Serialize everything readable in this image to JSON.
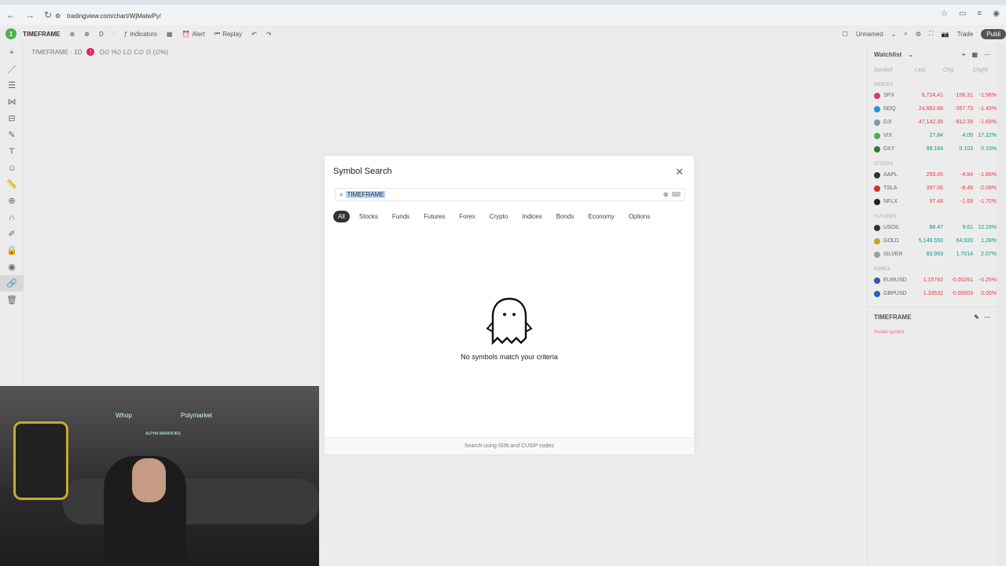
{
  "browser": {
    "url": "tradingview.com/chart/WjMatwPy/"
  },
  "toolbar": {
    "avatar": "1",
    "symbol": "TIMEFRAME",
    "interval": "D",
    "indicators": "Indicators",
    "alert": "Alert",
    "replay": "Replay",
    "layout_name": "Unnamed",
    "trade": "Trade",
    "publish": "Publi"
  },
  "chart": {
    "legend_title": "TIMEFRAME · 1D",
    "ohlc": "O∅ H∅ L∅ C∅ ∅ (∅%)"
  },
  "watchlist": {
    "title": "Watchlist",
    "cols": [
      "Symbol",
      "Last",
      "Chg",
      "Chg%"
    ],
    "sections": [
      {
        "name": "INDICES",
        "rows": [
          {
            "sym": "SPX",
            "last": "6,724.41",
            "chg": "-106.31",
            "pct": "-1.56%",
            "color": "#d23f67"
          },
          {
            "sym": "NDQ",
            "last": "24,662.68",
            "chg": "-357.73",
            "pct": "-1.43%",
            "color": "#2b8fd6"
          },
          {
            "sym": "DJI",
            "last": "47,142.35",
            "chg": "-812.39",
            "pct": "-1.69%",
            "color": "#8a94a0"
          },
          {
            "sym": "VIX",
            "last": "27.84",
            "chg": "4.09",
            "pct": "17.22%",
            "color": "#4caf50"
          },
          {
            "sym": "DXY",
            "last": "99.164",
            "chg": "0.103",
            "pct": "0.10%",
            "color": "#2e7d32"
          }
        ]
      },
      {
        "name": "STOCKS",
        "rows": [
          {
            "sym": "AAPL",
            "last": "255.45",
            "chg": "-4.84",
            "pct": "-1.86%",
            "color": "#333"
          },
          {
            "sym": "TSLA",
            "last": "397.06",
            "chg": "-8.49",
            "pct": "-2.09%",
            "color": "#d32f2f"
          },
          {
            "sym": "NFLX",
            "last": "97.48",
            "chg": "-1.69",
            "pct": "-1.70%",
            "color": "#222"
          }
        ]
      },
      {
        "name": "FUTURES",
        "rows": [
          {
            "sym": "USOIL",
            "last": "88.47",
            "chg": "9.61",
            "pct": "12.19%",
            "color": "#333"
          },
          {
            "sym": "GOLD",
            "last": "5,149.550",
            "chg": "64.920",
            "pct": "1.28%",
            "color": "#c9a227"
          },
          {
            "sym": "SILVER",
            "last": "83.963",
            "chg": "1.7014",
            "pct": "2.07%",
            "color": "#9e9e9e"
          }
        ]
      },
      {
        "name": "FOREX",
        "rows": [
          {
            "sym": "EURUSD",
            "last": "1.15792",
            "chg": "-0.00291",
            "pct": "-0.25%",
            "color": "#3f51b5"
          },
          {
            "sym": "GBPUSD",
            "last": "1.33532",
            "chg": "-0.00003",
            "pct": "0.00%",
            "color": "#1565c0"
          }
        ]
      }
    ],
    "detail_symbol": "TIMEFRAME",
    "detail_error": "Invalid symbol"
  },
  "dialog": {
    "title": "Symbol Search",
    "query": "TIMEFRAME",
    "filters": [
      "All",
      "Stocks",
      "Funds",
      "Futures",
      "Forex",
      "Crypto",
      "Indices",
      "Bonds",
      "Economy",
      "Options"
    ],
    "empty_message": "No symbols match your criteria",
    "footer": "Search using ISIN and CUSIP codes"
  },
  "webcam": {
    "logo1": "Whop",
    "logo2": "Polymarket",
    "logo3": "ALPHA WARRIORS"
  },
  "colors": {
    "positive": "#089981",
    "negative": "#f23645"
  }
}
